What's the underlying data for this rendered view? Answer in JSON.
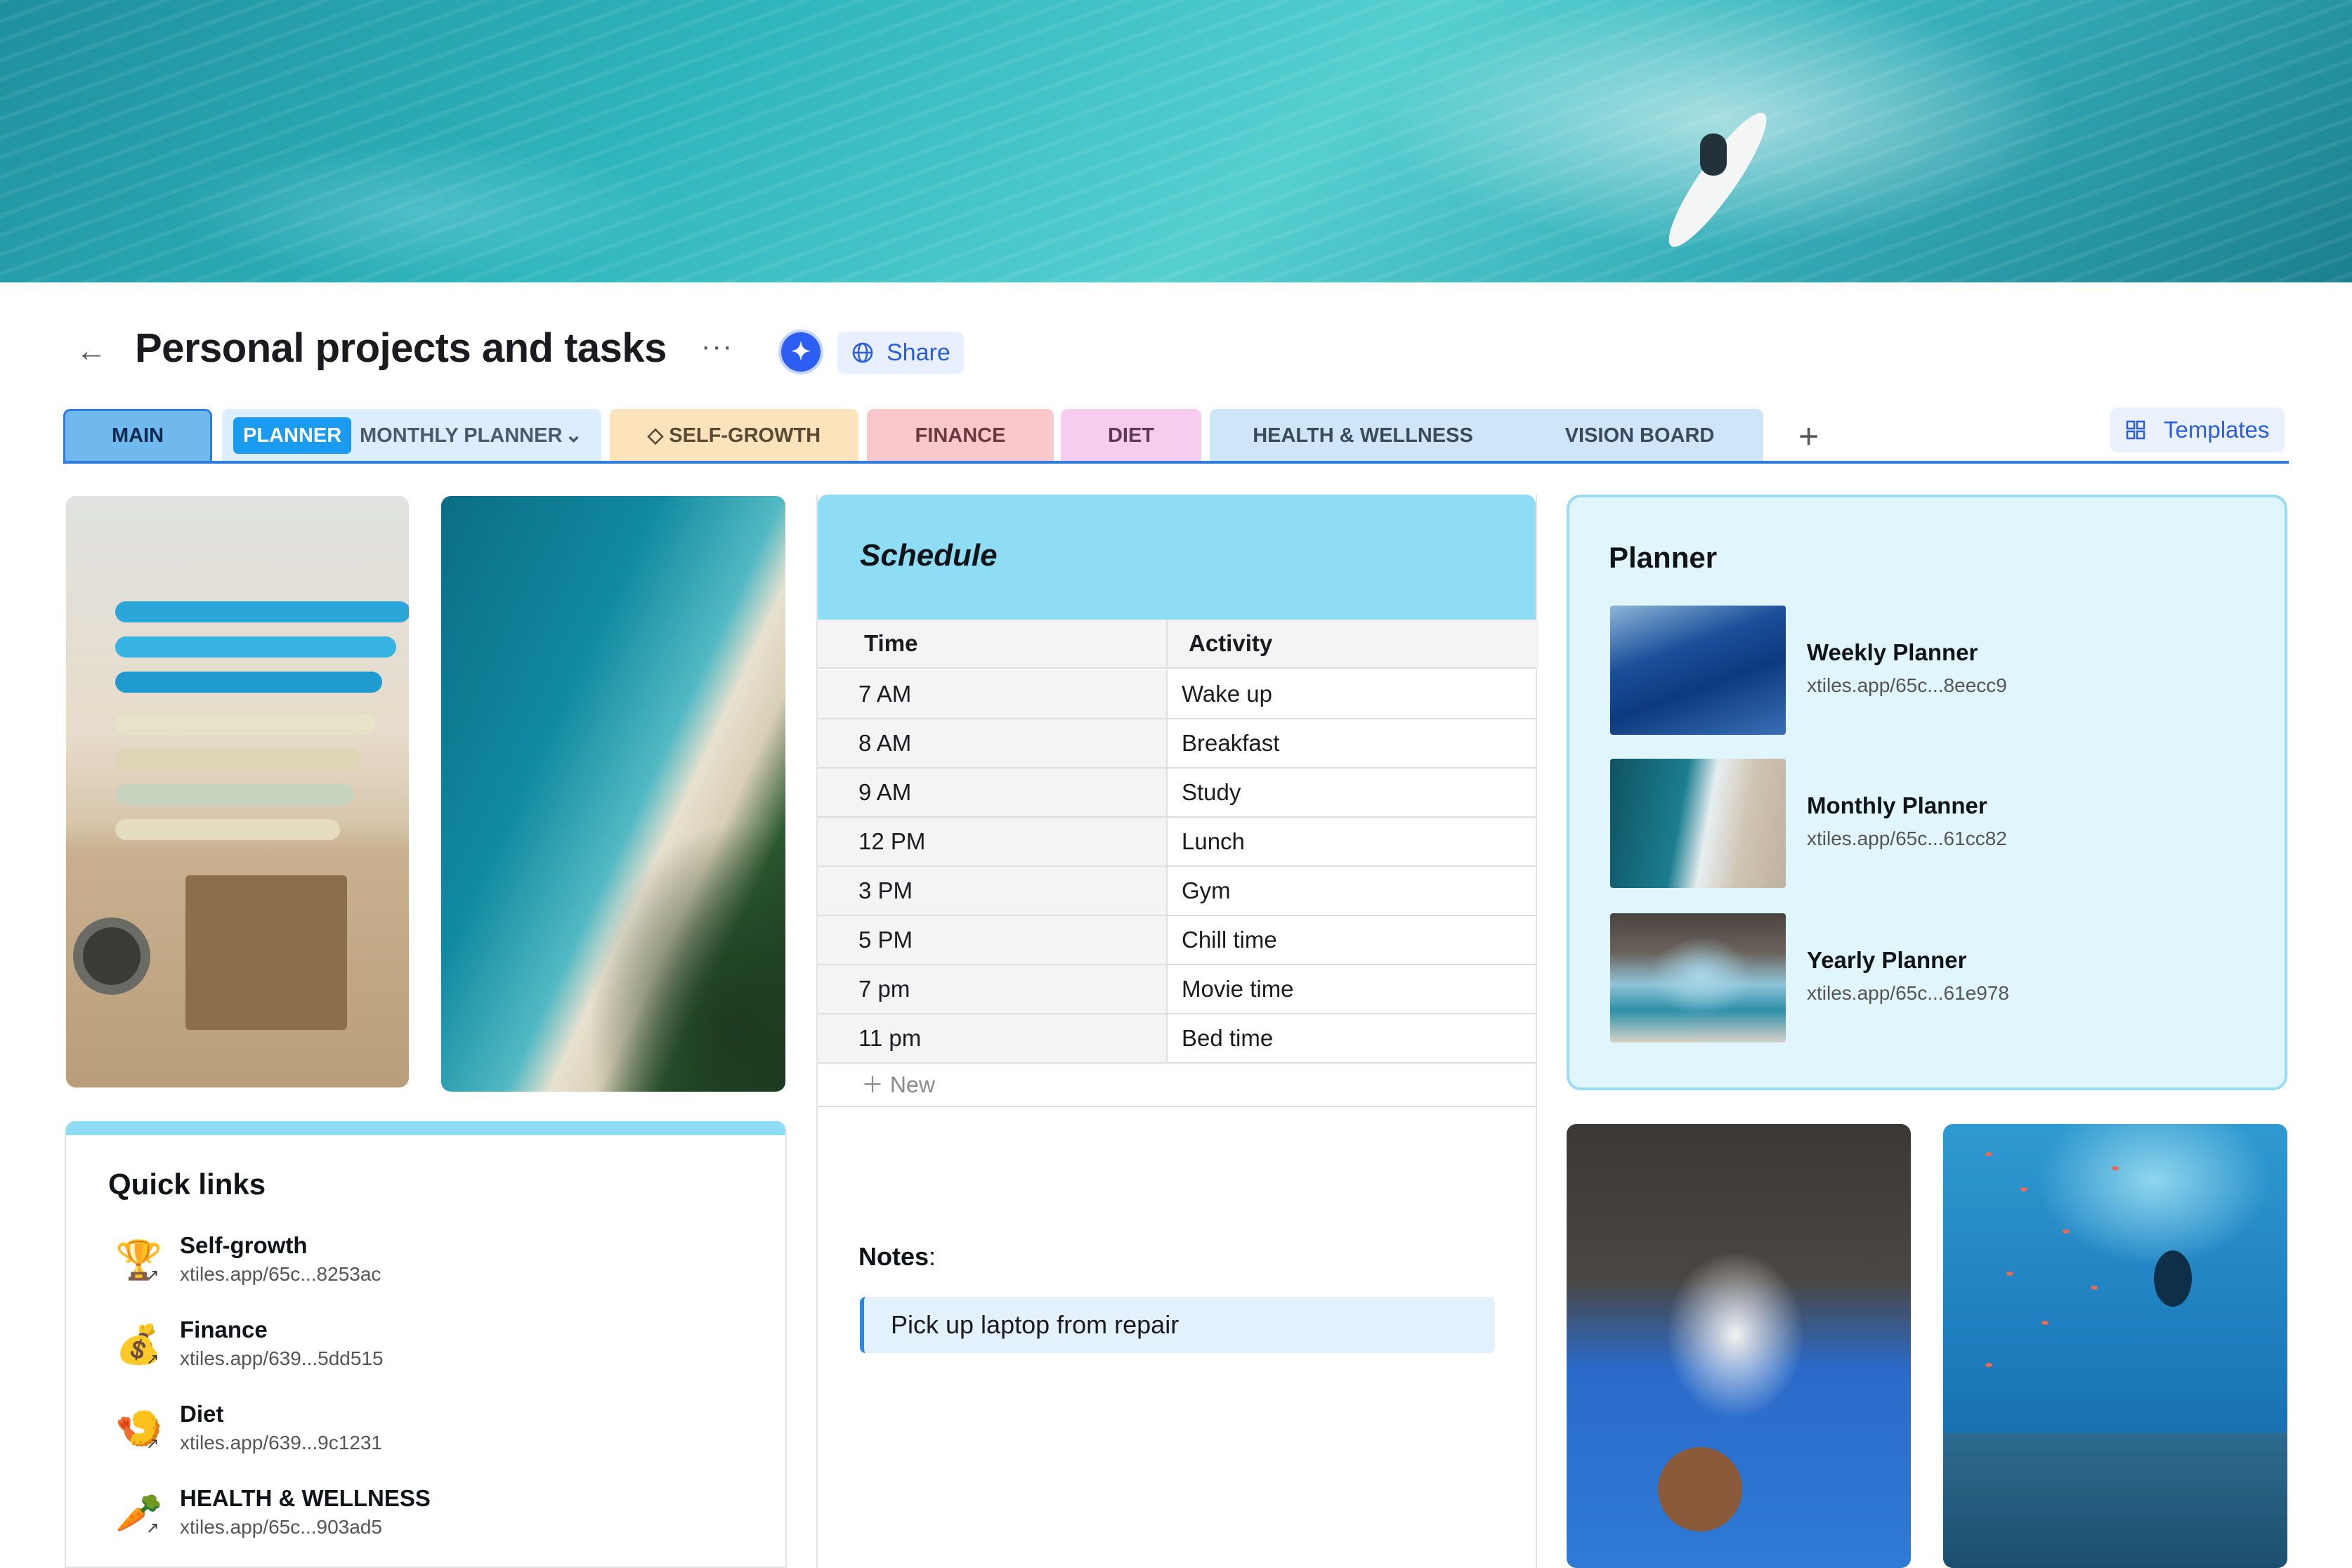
{
  "header": {
    "title": "Personal projects and tasks",
    "more_icon": "more-horizontal-icon",
    "share_label": "Share",
    "templates_label": "Templates"
  },
  "tabs": {
    "main": "MAIN",
    "planner_chip": "PLANNER",
    "planner_sub": "MONTHLY PLANNER",
    "self_growth": "SELF-GROWTH",
    "finance": "FINANCE",
    "diet": "DIET",
    "health": "HEALTH & WELLNESS",
    "vision": "VISION BOARD",
    "add": "+"
  },
  "colors": {
    "accent": "#2f7be0",
    "schedule_header": "#8fdcf5",
    "planner_bg": "#e1f5fd"
  },
  "schedule": {
    "title": "Schedule",
    "columns": [
      "Time",
      "Activity"
    ],
    "rows": [
      {
        "time": "7 AM",
        "activity": "Wake up"
      },
      {
        "time": "8 AM",
        "activity": "Breakfast"
      },
      {
        "time": "9 AM",
        "activity": "Study"
      },
      {
        "time": "12 PM",
        "activity": "Lunch"
      },
      {
        "time": "3 PM",
        "activity": "Gym"
      },
      {
        "time": "5 PM",
        "activity": "Chill time"
      },
      {
        "time": "7 pm",
        "activity": "Movie time"
      },
      {
        "time": "11 pm",
        "activity": "Bed time"
      }
    ],
    "new_label": "New"
  },
  "notes": {
    "label": "Notes",
    "colon": ":",
    "text": "Pick up laptop from repair"
  },
  "planner": {
    "title": "Planner",
    "items": [
      {
        "name": "Weekly Planner",
        "url": "xtiles.app/65c...8eecc9"
      },
      {
        "name": "Monthly Planner",
        "url": "xtiles.app/65c...61cc82"
      },
      {
        "name": "Yearly Planner",
        "url": "xtiles.app/65c...61e978"
      }
    ]
  },
  "quick_links": {
    "title": "Quick links",
    "items": [
      {
        "name": "Self-growth",
        "url": "xtiles.app/65c...8253ac",
        "icon": "trophy-icon",
        "glyph": "🏆"
      },
      {
        "name": "Finance",
        "url": "xtiles.app/639...5dd515",
        "icon": "money-bag-icon",
        "glyph": "💰"
      },
      {
        "name": "Diet",
        "url": "xtiles.app/639...9c1231",
        "icon": "shrimp-icon",
        "glyph": "🍤"
      },
      {
        "name": "HEALTH & WELLNESS",
        "url": "xtiles.app/65c...903ad5",
        "icon": "carrot-icon",
        "glyph": "🥕"
      }
    ]
  }
}
